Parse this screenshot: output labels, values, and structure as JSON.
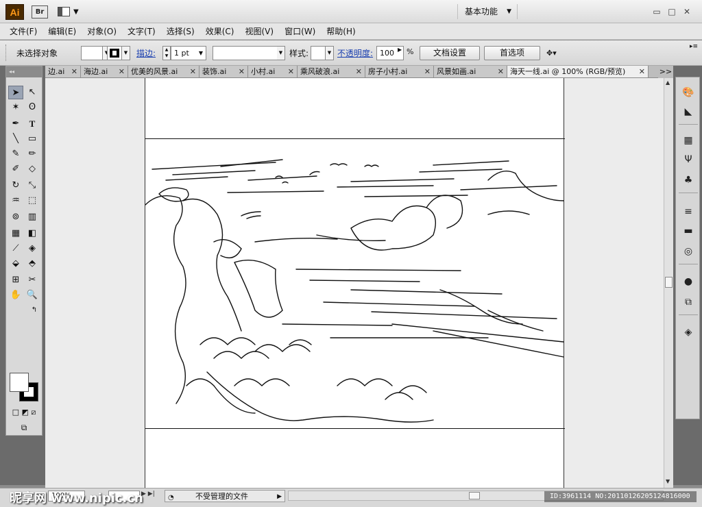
{
  "titlebar": {
    "app_logo": "Ai",
    "bridge_logo": "Br",
    "workspace": "基本功能",
    "icons": {
      "layout": "arrange-documents-icon",
      "minimize": "minimize-icon",
      "maximize": "maximize-icon",
      "close": "close-icon"
    }
  },
  "menu": [
    "文件(F)",
    "编辑(E)",
    "对象(O)",
    "文字(T)",
    "选择(S)",
    "效果(C)",
    "视图(V)",
    "窗口(W)",
    "帮助(H)"
  ],
  "control_bar": {
    "selection_status": "未选择对象",
    "stroke_label": "描边:",
    "stroke_weight": "1 pt",
    "style_label": "样式:",
    "opacity_label": "不透明度:",
    "opacity_value": "100",
    "opacity_unit": "%",
    "doc_setup": "文档设置",
    "preferences": "首选项"
  },
  "tabs": [
    {
      "label": "边.ai",
      "active": false
    },
    {
      "label": "海边.ai",
      "active": false
    },
    {
      "label": "优美的风景.ai",
      "active": false
    },
    {
      "label": "装饰.ai",
      "active": false
    },
    {
      "label": "小村.ai",
      "active": false
    },
    {
      "label": "乘风破浪.ai",
      "active": false
    },
    {
      "label": "房子小村.ai",
      "active": false
    },
    {
      "label": "风景如画.ai",
      "active": false
    },
    {
      "label": "海天一线.ai @ 100% (RGB/预览)",
      "active": true
    }
  ],
  "tab_more": ">>",
  "tools_left": [
    "selection-icon",
    "direct-selection-icon",
    "magic-wand-icon",
    "lasso-icon",
    "pen-icon",
    "type-icon",
    "line-icon",
    "rectangle-icon",
    "paintbrush-icon",
    "pencil-icon",
    "blob-brush-icon",
    "eraser-icon",
    "rotate-icon",
    "scale-icon",
    "warp-icon",
    "free-transform-icon",
    "symbol-sprayer-icon",
    "column-graph-icon",
    "mesh-icon",
    "gradient-icon",
    "eyedropper-icon",
    "blend-icon",
    "live-paint-icon",
    "live-paint-select-icon",
    "artboard-icon",
    "slice-icon",
    "hand-icon",
    "zoom-icon"
  ],
  "panel_right_icons": [
    "color-icon",
    "color-guide-icon",
    "swatches-icon",
    "brushes-icon",
    "symbols-icon",
    "stroke-icon",
    "gradient-panel-icon",
    "transparency-icon",
    "appearance-icon",
    "graphic-styles-icon",
    "layers-icon"
  ],
  "status": {
    "zoom": "100%",
    "text": "不受管理的文件"
  },
  "watermark": {
    "left": "昵享网 www.nipic.cn",
    "right": "ID:3961114 NO:20110126205124816000"
  }
}
